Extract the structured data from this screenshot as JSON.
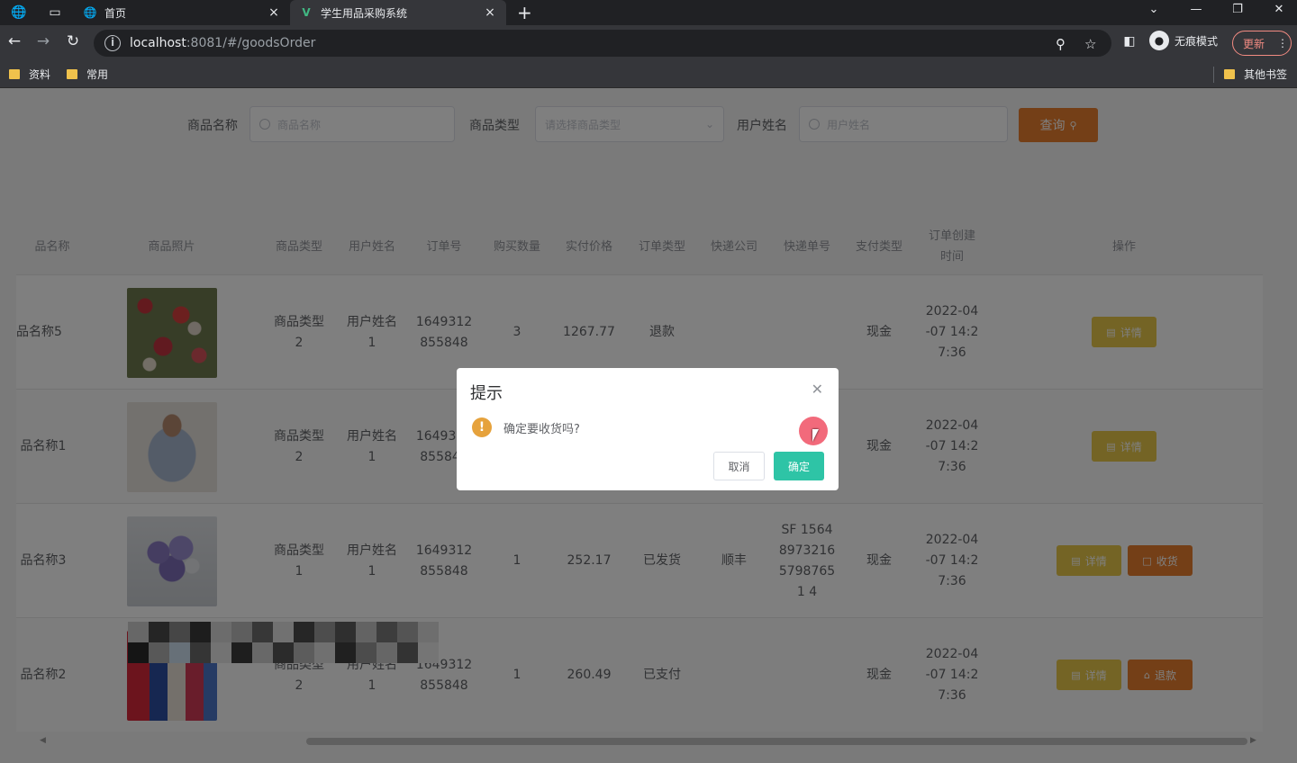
{
  "browser": {
    "tabs": [
      {
        "title": "首页",
        "active": false
      },
      {
        "title": "学生用品采购系统",
        "active": true
      }
    ],
    "url_host": "localhost",
    "url_path": ":8081/#/goodsOrder",
    "incognito_label": "无痕模式",
    "update_label": "更新",
    "bookmarks": [
      "资料",
      "常用"
    ],
    "other_bookmarks": "其他书签"
  },
  "search": {
    "goods_name_label": "商品名称",
    "goods_name_placeholder": "商品名称",
    "goods_type_label": "商品类型",
    "goods_type_placeholder": "请选择商品类型",
    "user_name_label": "用户姓名",
    "user_name_placeholder": "用户姓名",
    "query_button": "查询"
  },
  "table": {
    "headers": [
      "品名称",
      "商品照片",
      "商品类型",
      "用户姓名",
      "订单号",
      "购买数量",
      "实付价格",
      "订单类型",
      "快递公司",
      "快递单号",
      "支付类型",
      "订单创建时间",
      "操作"
    ],
    "rows": [
      {
        "name": "品名称5",
        "type": "商品类型2",
        "user": "用户姓名1",
        "order_no": "1649312855848",
        "qty": "3",
        "price": "1267.77",
        "order_type": "退款",
        "courier": "",
        "tracking": "",
        "pay": "现金",
        "created": "2022-04-07 14:27:36",
        "detail": "详情",
        "action": ""
      },
      {
        "name": "品名称1",
        "type": "商品类型2",
        "user": "用户姓名1",
        "order_no": "1649312855848",
        "qty": "",
        "price": "",
        "order_type": "",
        "courier": "",
        "tracking": "",
        "pay": "现金",
        "created": "2022-04-07 14:27:36",
        "detail": "详情",
        "action": ""
      },
      {
        "name": "品名称3",
        "type": "商品类型1",
        "user": "用户姓名1",
        "order_no": "1649312855848",
        "qty": "1",
        "price": "252.17",
        "order_type": "已发货",
        "courier": "顺丰",
        "tracking": "SF 1564897321657987651 4",
        "pay": "现金",
        "created": "2022-04-07 14:27:36",
        "detail": "详情",
        "action": "收货"
      },
      {
        "name": "品名称2",
        "type": "商品类型2",
        "user": "用户姓名1",
        "order_no": "1649312855848",
        "qty": "1",
        "price": "260.49",
        "order_type": "已支付",
        "courier": "",
        "tracking": "",
        "pay": "现金",
        "created": "2022-04-07 14:27:36",
        "detail": "详情",
        "action": "退款"
      }
    ]
  },
  "dialog": {
    "title": "提示",
    "message": "确定要收货吗?",
    "cancel": "取消",
    "confirm": "确定"
  },
  "colors": {
    "accent_green": "#2ec4a6",
    "warn_orange": "#e87f2e",
    "detail_yellow": "#e8c94a"
  }
}
